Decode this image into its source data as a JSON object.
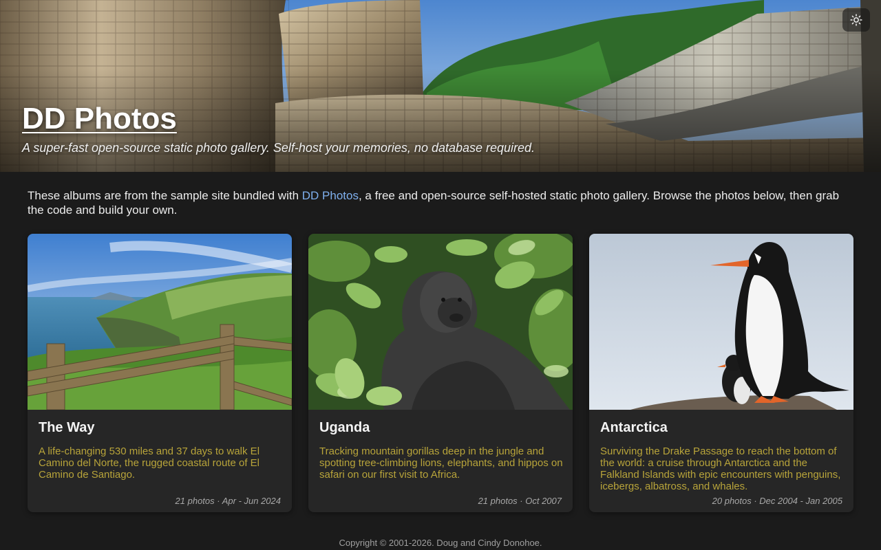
{
  "header": {
    "title": "DD Photos",
    "subtitle": "A super-fast open-source static photo gallery. Self-host your memories, no database required.",
    "theme_toggle_icon": "sun-icon"
  },
  "intro": {
    "before_link": "These albums are from the sample site bundled with ",
    "link_text": "DD Photos",
    "after_link": ", a free and open-source self-hosted static photo gallery. Browse the photos below, then grab the code and build your own."
  },
  "albums": [
    {
      "title": "The Way",
      "description": "A life-changing 530 miles and 37 days to walk El Camino del Norte, the rugged coastal route of El Camino de Santiago.",
      "meta": "21 photos · Apr - Jun 2024"
    },
    {
      "title": "Uganda",
      "description": "Tracking mountain gorillas deep in the jungle and spotting tree-climbing lions, elephants, and hippos on safari on our first visit to Africa.",
      "meta": "21 photos · Oct 2007"
    },
    {
      "title": "Antarctica",
      "description": "Surviving the Drake Passage to reach the bottom of the world: a cruise through Antarctica and the Falkland Islands with epic encounters with penguins, icebergs, albatross, and whales.",
      "meta": "20 photos · Dec 2004 - Jan 2005"
    }
  ],
  "footer": {
    "copyright": "Copyright © 2001-2026. Doug and Cindy Donohoe."
  },
  "colors": {
    "background": "#1b1b1b",
    "card": "#262626",
    "link": "#7fb0ee",
    "description": "#b8a43a"
  }
}
